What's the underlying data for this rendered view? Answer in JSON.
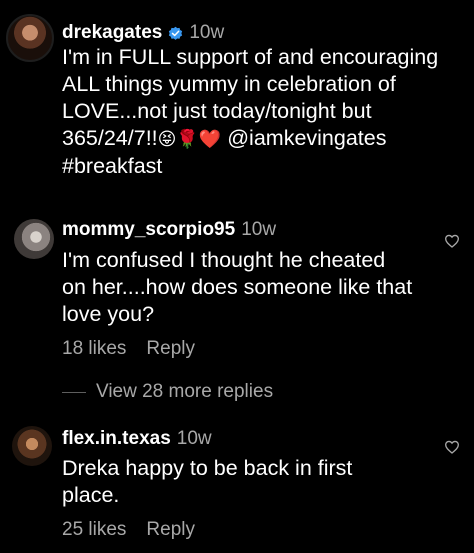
{
  "post": {
    "username": "drekagates",
    "time": "10w",
    "text_line1": "I'm in FULL support of and encouraging",
    "text_line2": "ALL things yummy in celebration of",
    "text_line3": "LOVE...not just today/tonight but",
    "text_line4_prefix": "365/24/7!!",
    "emojis": "😝🌹❤️",
    "mention": "@iamkevingates",
    "hashtag": "#breakfast"
  },
  "comments": [
    {
      "username": "mommy_scorpio95",
      "time": "10w",
      "text_line1": "I'm confused I thought he cheated",
      "text_line2": "on her....how does someone like that",
      "text_line3": "love you?",
      "likes": "18 likes",
      "reply": "Reply"
    },
    {
      "username": "flex.in.texas",
      "time": "10w",
      "text_line1": "Dreka happy to be back in first",
      "text_line2": "place.",
      "likes": "25 likes",
      "reply": "Reply"
    }
  ],
  "view_replies": "View 28 more replies",
  "icons": {
    "verified": "verified-badge-icon",
    "heart": "heart-icon"
  },
  "colors": {
    "verified": "#3897f0",
    "secondary_text": "#a8a8a8"
  }
}
